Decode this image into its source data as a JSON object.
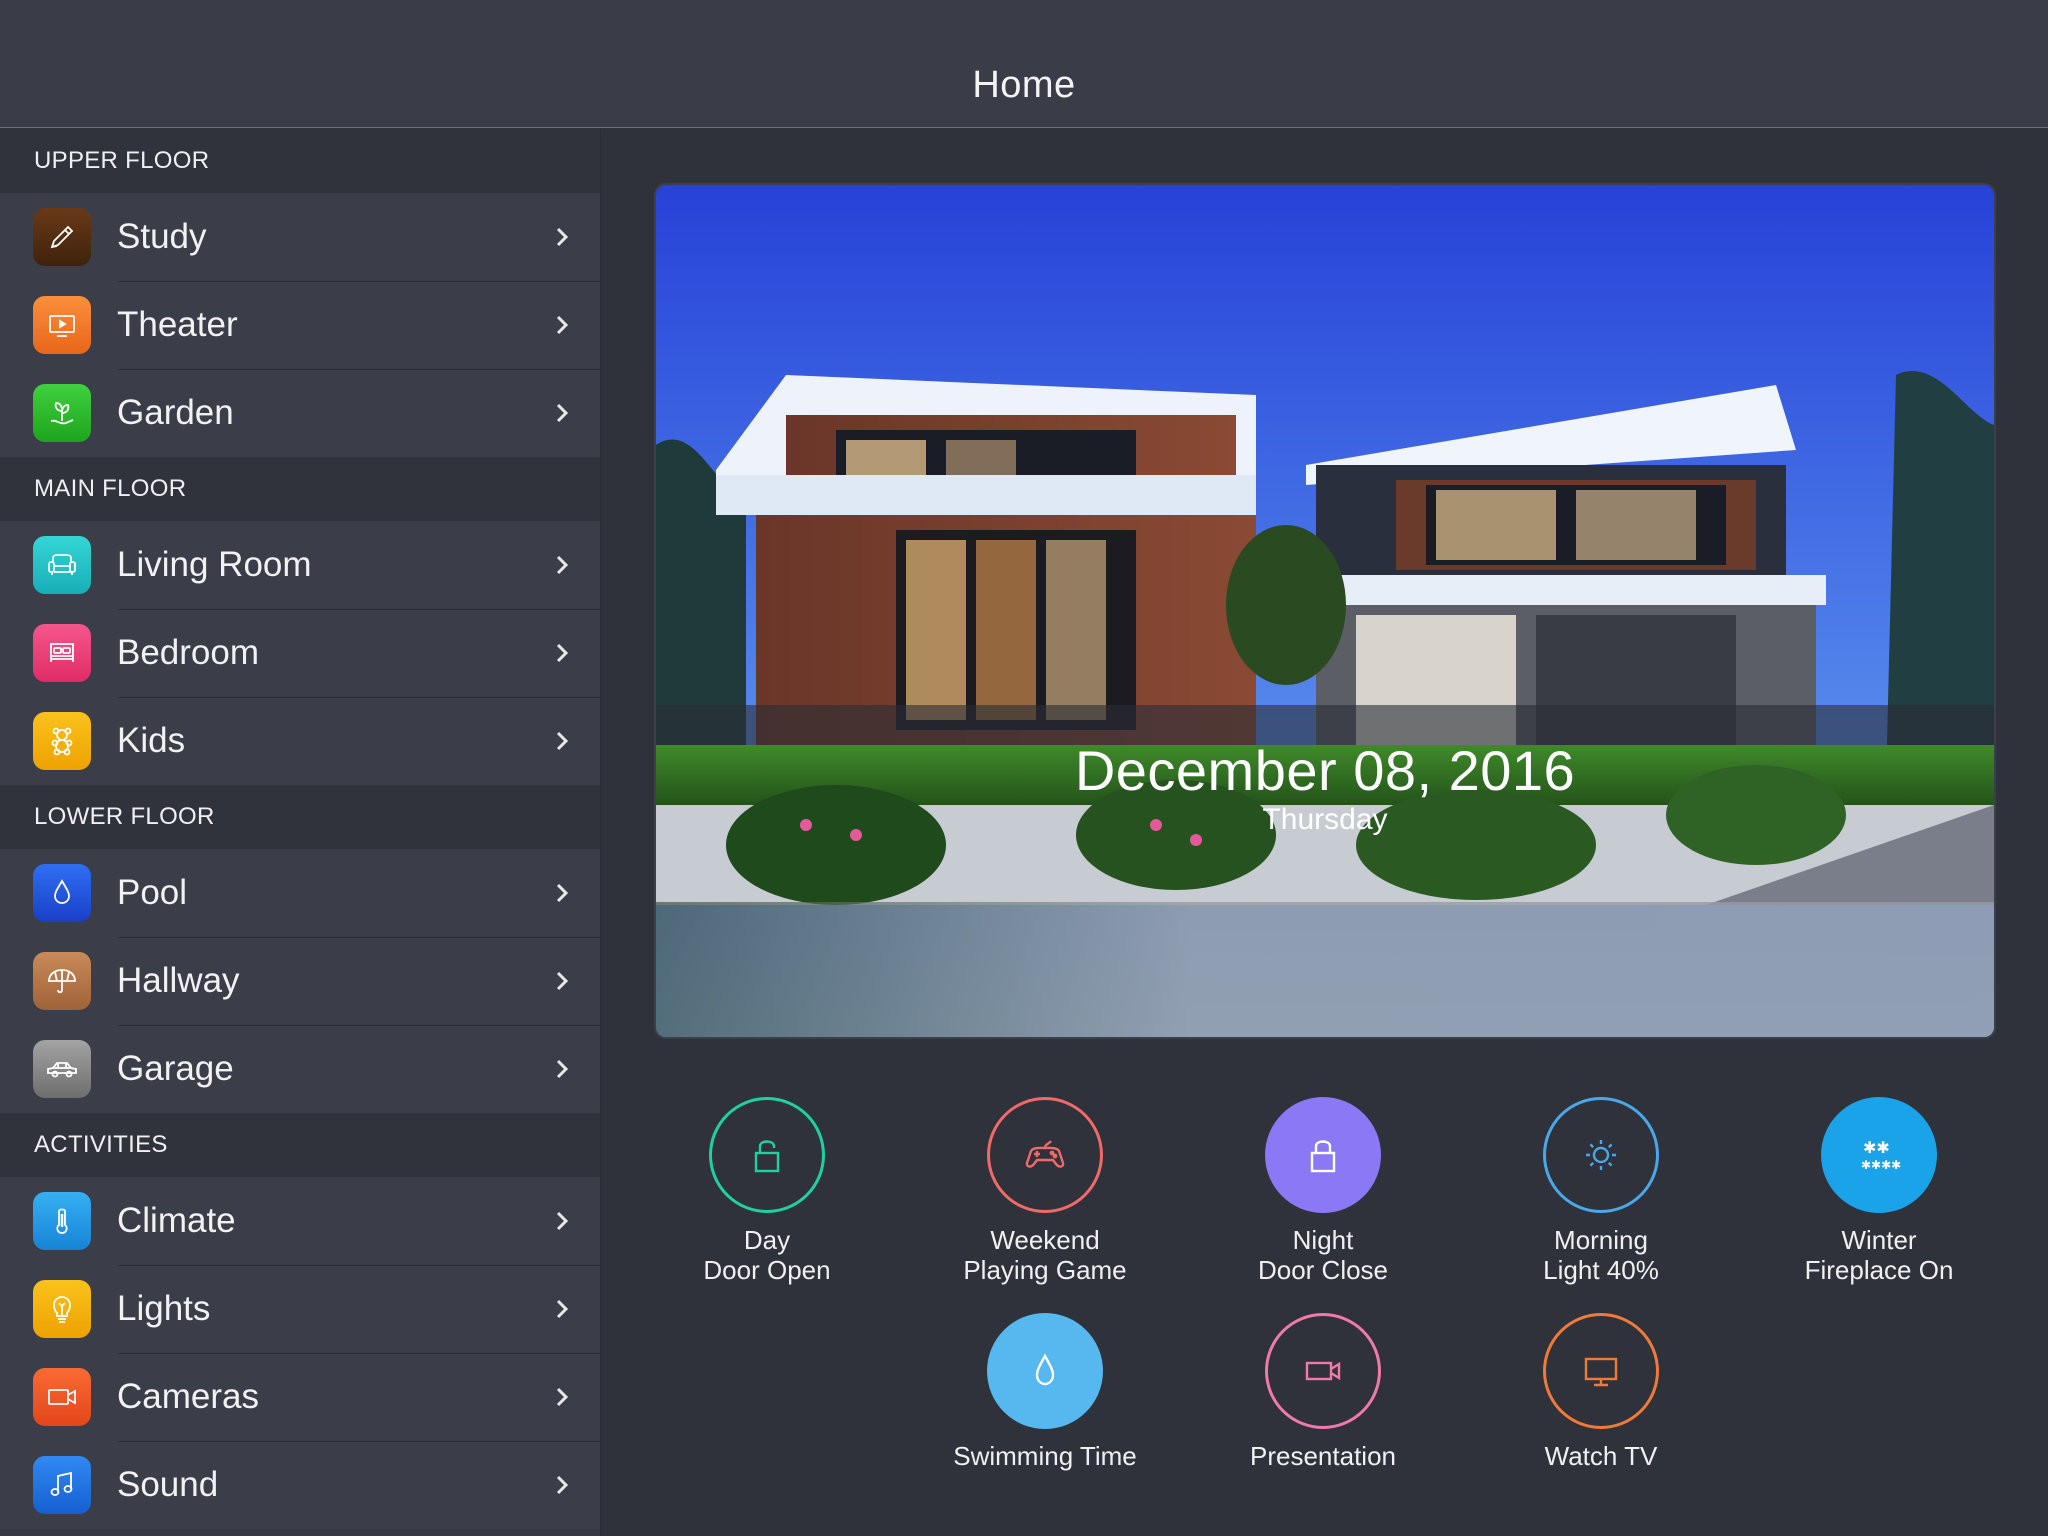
{
  "header": {
    "title": "Home"
  },
  "sidebar": {
    "sections": [
      {
        "title": "UPPER FLOOR",
        "items": [
          {
            "label": "Study",
            "icon": "pencil-icon",
            "color": "#5a3214"
          },
          {
            "label": "Theater",
            "icon": "tv-icon",
            "color": "#f07a22"
          },
          {
            "label": "Garden",
            "icon": "plant-icon",
            "color": "#2db52d"
          }
        ]
      },
      {
        "title": "MAIN FLOOR",
        "items": [
          {
            "label": "Living Room",
            "icon": "sofa-icon",
            "color": "#1fc4c4"
          },
          {
            "label": "Bedroom",
            "icon": "bed-icon",
            "color": "#ef3f7a"
          },
          {
            "label": "Kids",
            "icon": "teddy-bear-icon",
            "color": "#f4b400"
          }
        ]
      },
      {
        "title": "LOWER FLOOR",
        "items": [
          {
            "label": "Pool",
            "icon": "water-drop-icon",
            "color": "#2357e0"
          },
          {
            "label": "Hallway",
            "icon": "umbrella-icon",
            "color": "#b8784a"
          },
          {
            "label": "Garage",
            "icon": "car-icon",
            "color": "#8a8a8a"
          }
        ]
      },
      {
        "title": "ACTIVITIES",
        "items": [
          {
            "label": "Climate",
            "icon": "thermometer-icon",
            "color": "#1e9be8"
          },
          {
            "label": "Lights",
            "icon": "lightbulb-icon",
            "color": "#f4b400"
          },
          {
            "label": "Cameras",
            "icon": "video-camera-icon",
            "color": "#f25a24"
          },
          {
            "label": "Sound",
            "icon": "music-note-icon",
            "color": "#1e74e8"
          }
        ]
      }
    ]
  },
  "hero": {
    "date": "December 08, 2016",
    "weekday": "Thursday"
  },
  "scenes": [
    {
      "line1": "Day",
      "line2": "Door Open",
      "icon": "lock-open-icon",
      "color": "#1fd1a0",
      "filled": false
    },
    {
      "line1": "Weekend",
      "line2": "Playing Game",
      "icon": "gamepad-icon",
      "color": "#f06a6a",
      "filled": false
    },
    {
      "line1": "Night",
      "line2": "Door Close",
      "icon": "lock-closed-icon",
      "color": "#8a78f5",
      "filled": true
    },
    {
      "line1": "Morning",
      "line2": "Light 40%",
      "icon": "sun-icon",
      "color": "#4aa8e8",
      "filled": false
    },
    {
      "line1": "Winter",
      "line2": "Fireplace On",
      "icon": "snowflake-icon",
      "color": "#1aa3e8",
      "filled": true
    },
    {
      "line1": "Swimming Time",
      "line2": "",
      "icon": "water-drop-icon",
      "color": "#56b8ef",
      "filled": true
    },
    {
      "line1": "Presentation",
      "line2": "",
      "icon": "video-camera-icon",
      "color": "#f07aa8",
      "filled": false
    },
    {
      "line1": "Watch TV",
      "line2": "",
      "icon": "tv-icon",
      "color": "#f07a3a",
      "filled": false
    }
  ]
}
